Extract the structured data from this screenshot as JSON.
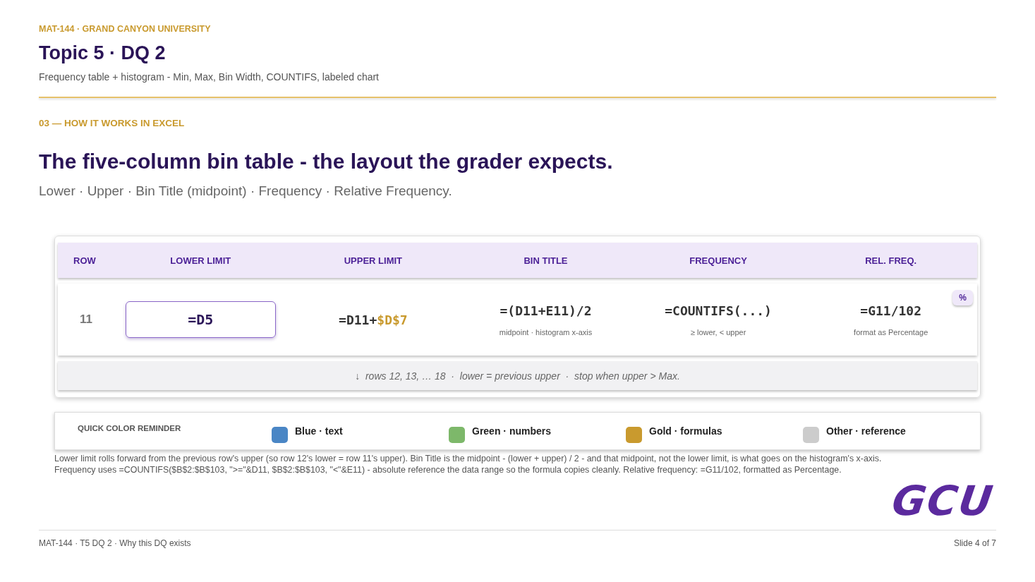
{
  "header": {
    "eyebrow": "MAT-144 · GRAND CANYON UNIVERSITY",
    "title": "Topic 5 · DQ 2",
    "subtitle": "Frequency table + histogram - Min, Max, Bin Width, COUNTIFS, labeled chart"
  },
  "section": {
    "label": "03 — HOW IT WORKS IN EXCEL",
    "heading": "The five-column bin table - the layout the grader expects.",
    "lead": "Lower · Upper · Bin Title (midpoint) · Frequency · Relative Frequency."
  },
  "table": {
    "columns": [
      "ROW",
      "LOWER LIMIT",
      "UPPER LIMIT",
      "BIN TITLE",
      "FREQUENCY",
      "REL. FREQ."
    ],
    "row_number": "11",
    "cells": [
      {
        "parts": [
          {
            "text": "=D5",
            "kind": "plain"
          }
        ],
        "selected": true
      },
      {
        "parts": [
          {
            "text": "=D11+",
            "kind": "plain"
          },
          {
            "text": "$D$7",
            "kind": "absolute"
          }
        ],
        "selected": false
      },
      {
        "parts": [
          {
            "text": "=(D11+E11)/2",
            "kind": "plain"
          }
        ],
        "note": "midpoint · histogram x-axis",
        "selected": false
      },
      {
        "parts": [
          {
            "text": "=COUNTIFS(...)",
            "kind": "plain"
          }
        ],
        "note": "≥ lower, < upper",
        "selected": false
      },
      {
        "parts": [
          {
            "text": "=G11/102",
            "kind": "plain"
          }
        ],
        "note": "format as Percentage",
        "selected": false
      }
    ],
    "badge": "%",
    "continuation": "↓  rows 12, 13, … 18  ·  lower = previous upper  ·  stop when upper > Max."
  },
  "legend": {
    "title": "QUICK COLOR REMINDER",
    "items": [
      {
        "label": "Blue · text",
        "color": "#4a86c5"
      },
      {
        "label": "Green · numbers",
        "color": "#7db86a"
      },
      {
        "label": "Gold · formulas",
        "color": "#c99a2e"
      },
      {
        "label": "Other · reference",
        "color": "#cccccc"
      }
    ]
  },
  "notes": [
    "Lower limit rolls forward from the previous row's upper (so row 12's lower = row 11's upper). Bin Title is the midpoint - (lower + upper) / 2 - and that midpoint, not the lower limit, is what goes on the histogram's x-axis.",
    "Frequency uses =COUNTIFS($B$2:$B$103, \">=\"&D11, $B$2:$B$103, \"<\"&E11) - absolute reference the data range so the formula copies cleanly. Relative frequency: =G11/102, formatted as Percentage."
  ],
  "logo": "GCU",
  "footer": {
    "left": "MAT-144 · T5 DQ 2 · Why this DQ exists",
    "right": "Slide 4 of 7"
  }
}
